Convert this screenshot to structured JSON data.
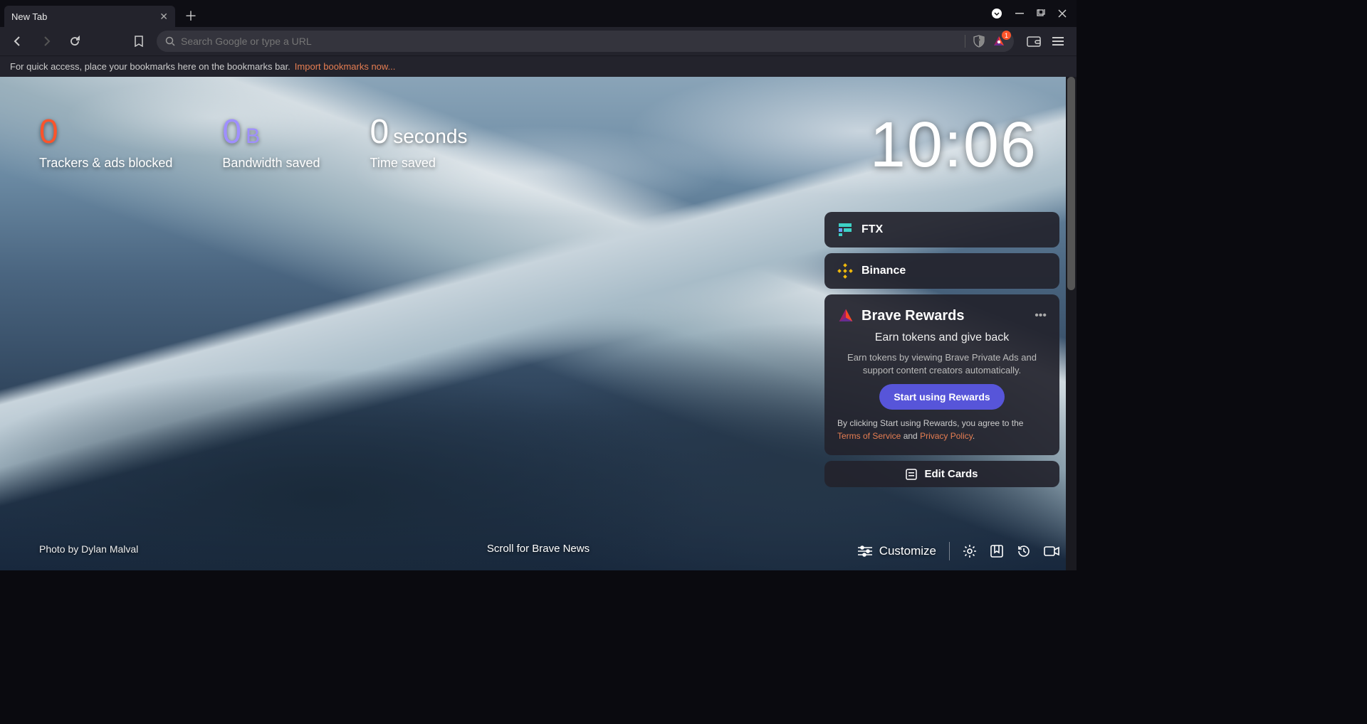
{
  "tab": {
    "title": "New Tab"
  },
  "addr": {
    "placeholder": "Search Google or type a URL"
  },
  "rewards_badge": "1",
  "bookmarks_hint": "For quick access, place your bookmarks here on the bookmarks bar.",
  "bookmarks_import": "Import bookmarks now...",
  "stats": {
    "trackers": {
      "value": "0",
      "label": "Trackers & ads blocked"
    },
    "bandwidth": {
      "value": "0",
      "unit": "B",
      "label": "Bandwidth saved"
    },
    "time": {
      "value": "0",
      "unit": "seconds",
      "label": "Time saved"
    }
  },
  "clock": "10:06",
  "cards": {
    "ftx": {
      "label": "FTX"
    },
    "binance": {
      "label": "Binance"
    },
    "rewards": {
      "title": "Brave Rewards",
      "subtitle": "Earn tokens and give back",
      "desc": "Earn tokens by viewing Brave Private Ads and support content creators automatically.",
      "button": "Start using Rewards",
      "terms_pre": "By clicking Start using Rewards, you agree to the ",
      "tos": "Terms of Service",
      "and": " and ",
      "privacy": "Privacy Policy",
      "dot": "."
    },
    "edit": "Edit Cards"
  },
  "photo_credit": "Photo by Dylan Malval",
  "scroll_news": "Scroll for Brave News",
  "customize": "Customize"
}
